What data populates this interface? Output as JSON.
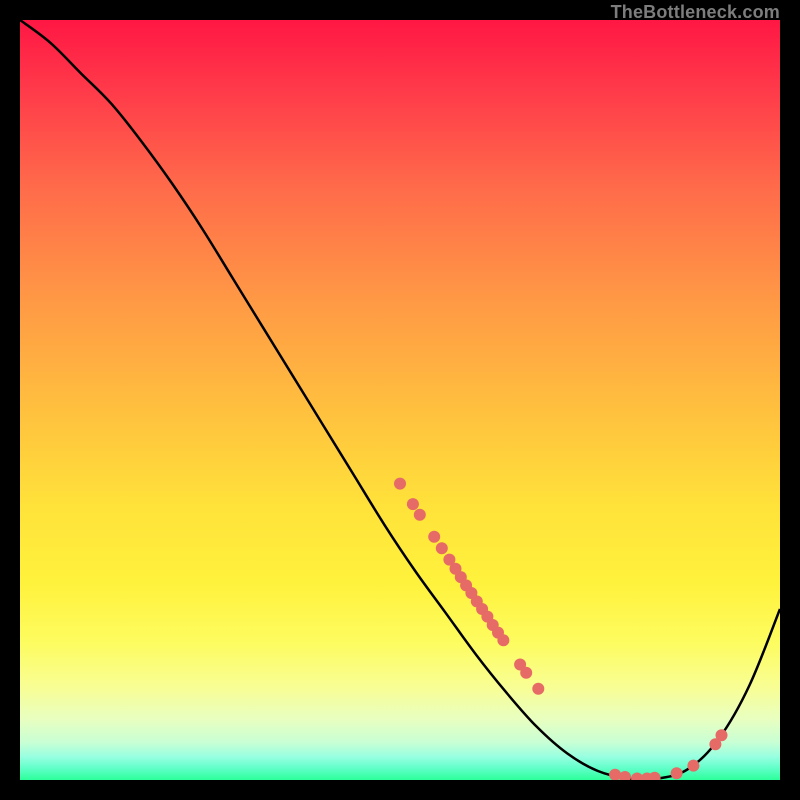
{
  "watermark": "TheBottleneck.com",
  "colors": {
    "curve": "#000000",
    "dot": "#e66a66",
    "background_top": "#ff1744",
    "background_bottom": "#2cff9a"
  },
  "chart_data": {
    "type": "line",
    "title": "",
    "xlabel": "",
    "ylabel": "",
    "xlim": [
      0,
      100
    ],
    "ylim": [
      0,
      100
    ],
    "curve": {
      "x": [
        0,
        4,
        8,
        12,
        16,
        20,
        24,
        28,
        32,
        36,
        40,
        44,
        48,
        52,
        56,
        60,
        64,
        68,
        72,
        76,
        80,
        84,
        88,
        92,
        96,
        100
      ],
      "y": [
        100,
        97,
        93,
        89,
        84,
        78.5,
        72.5,
        66,
        59.5,
        53,
        46.5,
        40,
        33.5,
        27.5,
        22,
        16.5,
        11.5,
        7.0,
        3.5,
        1.2,
        0.2,
        0.2,
        1.5,
        5.5,
        12.5,
        22.5
      ]
    },
    "points": [
      {
        "x": 50.0,
        "y": 39.0
      },
      {
        "x": 51.7,
        "y": 36.3
      },
      {
        "x": 52.6,
        "y": 34.9
      },
      {
        "x": 54.5,
        "y": 32.0
      },
      {
        "x": 55.5,
        "y": 30.5
      },
      {
        "x": 56.5,
        "y": 29.0
      },
      {
        "x": 57.3,
        "y": 27.8
      },
      {
        "x": 58.0,
        "y": 26.7
      },
      {
        "x": 58.7,
        "y": 25.6
      },
      {
        "x": 59.4,
        "y": 24.6
      },
      {
        "x": 60.1,
        "y": 23.5
      },
      {
        "x": 60.8,
        "y": 22.5
      },
      {
        "x": 61.5,
        "y": 21.5
      },
      {
        "x": 62.2,
        "y": 20.4
      },
      {
        "x": 62.9,
        "y": 19.4
      },
      {
        "x": 63.6,
        "y": 18.4
      },
      {
        "x": 65.8,
        "y": 15.2
      },
      {
        "x": 66.6,
        "y": 14.1
      },
      {
        "x": 68.2,
        "y": 12.0
      },
      {
        "x": 78.3,
        "y": 0.7
      },
      {
        "x": 79.6,
        "y": 0.4
      },
      {
        "x": 81.2,
        "y": 0.2
      },
      {
        "x": 82.5,
        "y": 0.2
      },
      {
        "x": 83.5,
        "y": 0.3
      },
      {
        "x": 86.4,
        "y": 0.9
      },
      {
        "x": 88.6,
        "y": 1.9
      },
      {
        "x": 91.5,
        "y": 4.7
      },
      {
        "x": 92.3,
        "y": 5.9
      }
    ],
    "dot_radius_px": 6
  }
}
